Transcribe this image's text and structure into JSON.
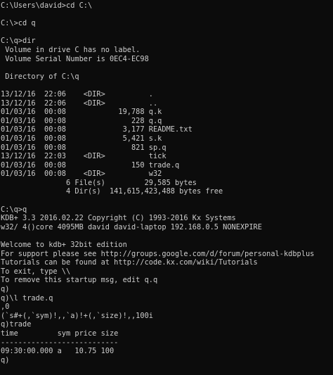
{
  "terminal": {
    "lines": [
      "C:\\Users\\david>cd C:\\",
      "",
      "C:\\>cd q",
      "",
      "C:\\q>dir",
      " Volume in drive C has no label.",
      " Volume Serial Number is 0EC4-EC98",
      "",
      " Directory of C:\\q",
      "",
      "13/12/16  22:06    <DIR>          .",
      "13/12/16  22:06    <DIR>          ..",
      "01/03/16  00:08            19,788 q.k",
      "01/03/16  00:08               228 q.q",
      "01/03/16  00:08             3,177 README.txt",
      "01/03/16  00:08             5,421 s.k",
      "01/03/16  00:08               821 sp.q",
      "13/12/16  22:03    <DIR>          tick",
      "01/03/16  00:08               150 trade.q",
      "01/03/16  00:08    <DIR>          w32",
      "               6 File(s)         29,585 bytes",
      "               4 Dir(s)  141,615,423,488 bytes free",
      "",
      "C:\\q>q",
      "KDB+ 3.3 2016.02.22 Copyright (C) 1993-2016 Kx Systems",
      "w32/ 4()core 4095MB david david-laptop 192.168.0.5 NONEXPIRE",
      "",
      "Welcome to kdb+ 32bit edition",
      "For support please see http://groups.google.com/d/forum/personal-kdbplus",
      "Tutorials can be found at http://code.kx.com/wiki/Tutorials",
      "To exit, type \\\\",
      "To remove this startup msg, edit q.q",
      "q)",
      "q)\\l trade.q",
      ",0",
      "(`s#+(,`sym)!,,`a)!+(,`size)!,,100i",
      "q)trade",
      "time         sym price size",
      "---------------------------",
      "09:30:00.000 a   10.75 100",
      "q)"
    ]
  }
}
